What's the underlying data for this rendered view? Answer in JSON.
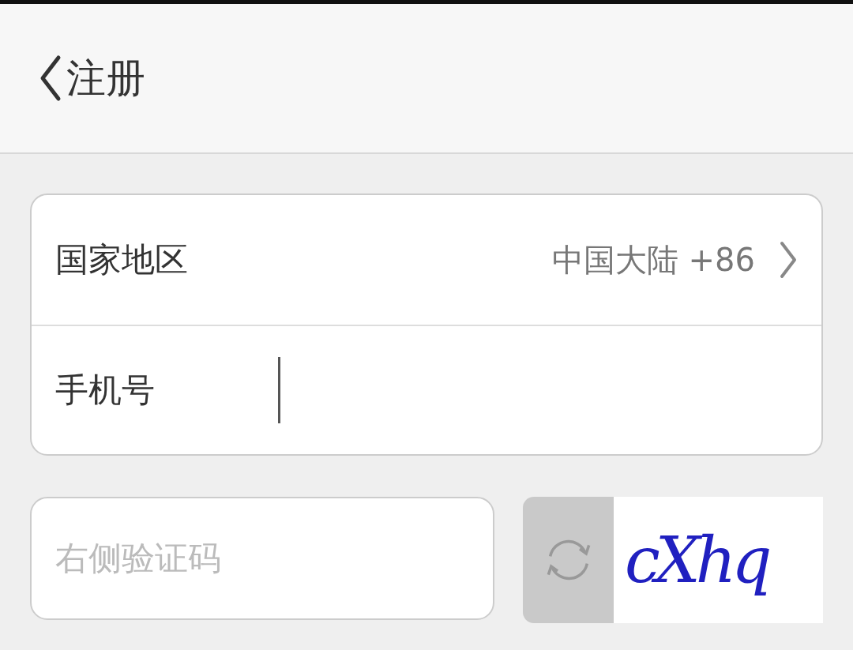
{
  "header": {
    "title": "注册"
  },
  "form": {
    "rows": [
      {
        "kind": "select",
        "label": "国家地区",
        "value": "中国大陆 +86"
      },
      {
        "kind": "input",
        "label": "手机号",
        "focused": true
      }
    ]
  },
  "captcha": {
    "placeholder": "右侧验证码",
    "code": "cXhq"
  }
}
